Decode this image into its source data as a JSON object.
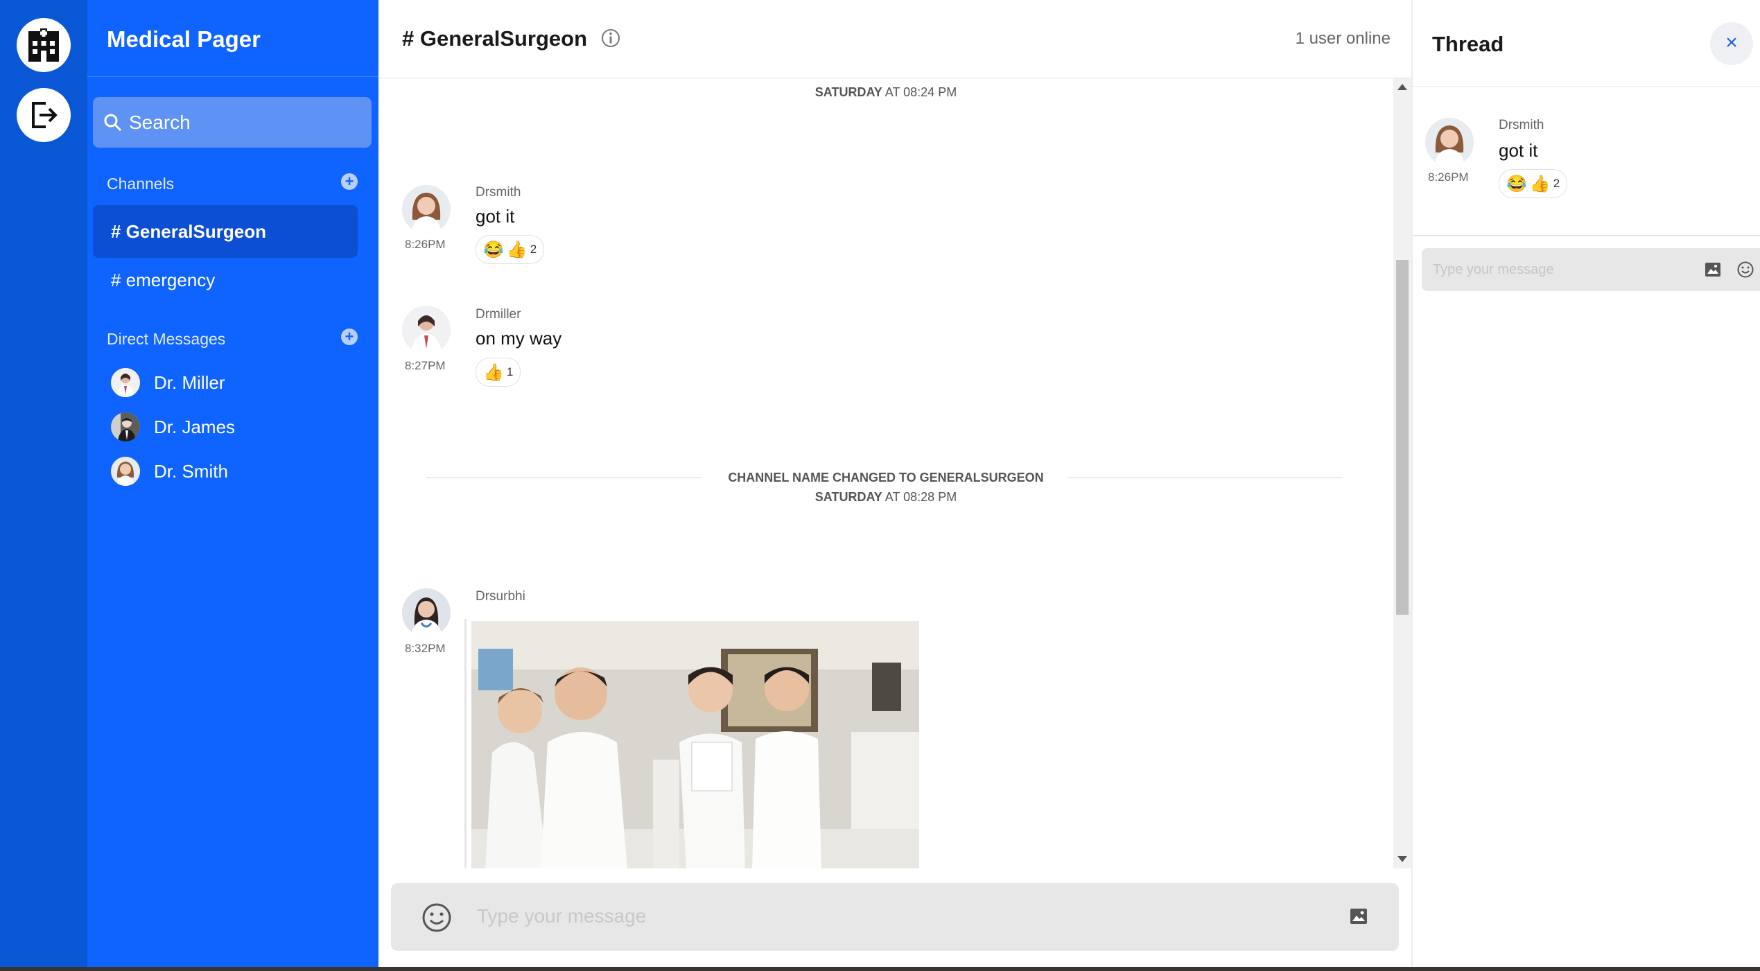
{
  "app": {
    "title": "Medical Pager"
  },
  "rail": {
    "logo_icon": "hospital-icon",
    "logout_icon": "logout-icon"
  },
  "sidebar": {
    "search": {
      "placeholder": "Search"
    },
    "channels_title": "Channels",
    "channels": [
      {
        "label": "# GeneralSurgeon",
        "active": true
      },
      {
        "label": "# emergency",
        "active": false
      }
    ],
    "dm_title": "Direct Messages",
    "dms": [
      {
        "name": "Dr. Miller"
      },
      {
        "name": "Dr. James"
      },
      {
        "name": "Dr. Smith"
      }
    ]
  },
  "channel": {
    "name": "# GeneralSurgeon",
    "online": "1 user online",
    "messages": {
      "date1": {
        "day": "SATURDAY",
        "rest": " AT 08:24 PM"
      },
      "m1": {
        "user": "Drsmith",
        "time": "8:26PM",
        "text": "got it",
        "reactions": [
          {
            "emoji": "😂"
          },
          {
            "emoji": "👍",
            "count": "2"
          }
        ]
      },
      "m2": {
        "user": "Drmiller",
        "time": "8:27PM",
        "text": "on my way",
        "reactions": [
          {
            "emoji": "👍",
            "count": "1"
          }
        ]
      },
      "system": {
        "text": "CHANNEL NAME CHANGED TO GENERALSURGEON",
        "day": "SATURDAY",
        "rest": " AT 08:28 PM"
      },
      "m3": {
        "user": "Drsurbhi",
        "time": "8:32PM"
      }
    },
    "composer": {
      "placeholder": "Type your message"
    }
  },
  "thread": {
    "title": "Thread",
    "close": "×",
    "message": {
      "user": "Drsmith",
      "time": "8:26PM",
      "text": "got it",
      "reactions": [
        {
          "emoji": "😂"
        },
        {
          "emoji": "👍",
          "count": "2"
        }
      ]
    },
    "composer": {
      "placeholder": "Type your message"
    }
  },
  "colors": {
    "rail": "#0a57d6",
    "sidebar": "#0f63ff",
    "active_channel": "#0c4fd2",
    "search_bg": "#5e92f5"
  }
}
